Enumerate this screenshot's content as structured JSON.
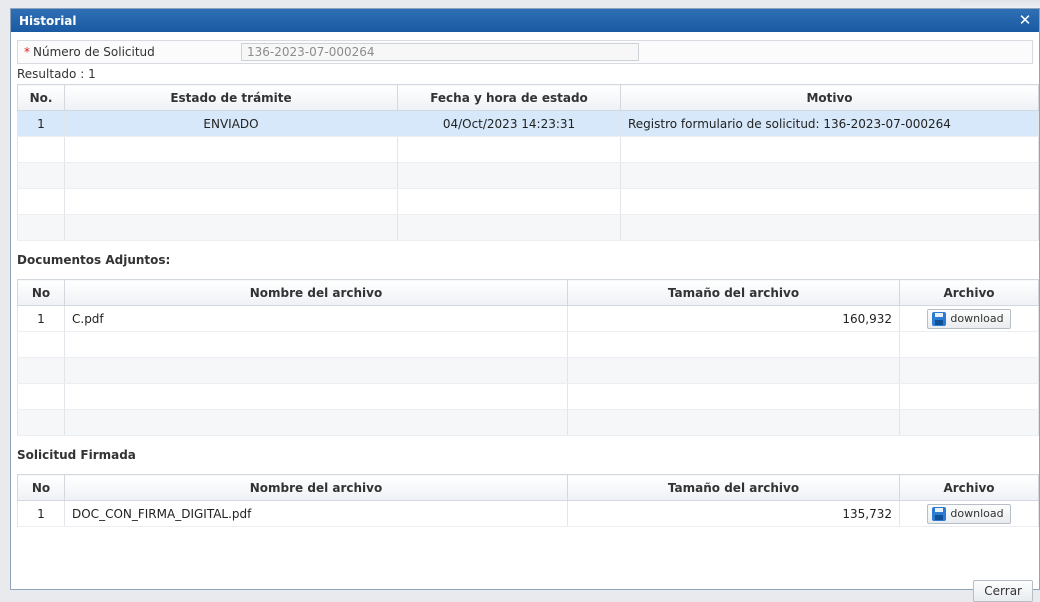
{
  "dialog": {
    "title": "Historial",
    "close_glyph": "✕"
  },
  "request": {
    "required_marker": "*",
    "label": "Número de Solicitud",
    "value": "136-2023-07-000264",
    "result_text": "Resultado : 1"
  },
  "history": {
    "headers": [
      "No.",
      "Estado de trámite",
      "Fecha y hora de estado",
      "Motivo"
    ],
    "rows": [
      {
        "no": "1",
        "estado": "ENVIADO",
        "fecha": "04/Oct/2023 14:23:31",
        "motivo": "Registro formulario de solicitud: 136-2023-07-000264"
      }
    ]
  },
  "attachments": {
    "title": "Documentos Adjuntos:",
    "headers": [
      "No",
      "Nombre del archivo",
      "Tamaño del archivo",
      "Archivo"
    ],
    "rows": [
      {
        "no": "1",
        "name": "C.pdf",
        "size": "160,932",
        "button": "download"
      }
    ]
  },
  "signed": {
    "title": "Solicitud Firmada",
    "headers": [
      "No",
      "Nombre del archivo",
      "Tamaño del archivo",
      "Archivo"
    ],
    "rows": [
      {
        "no": "1",
        "name": "DOC_CON_FIRMA_DIGITAL.pdf",
        "size": "135,732",
        "button": "download"
      }
    ]
  },
  "footer": {
    "close_label": "Cerrar"
  },
  "icons": {
    "close": "close-icon",
    "download": "floppy-disk-icon"
  },
  "colors": {
    "titlebar": "#1f63ad",
    "selected_row": "#d6e8f9"
  }
}
